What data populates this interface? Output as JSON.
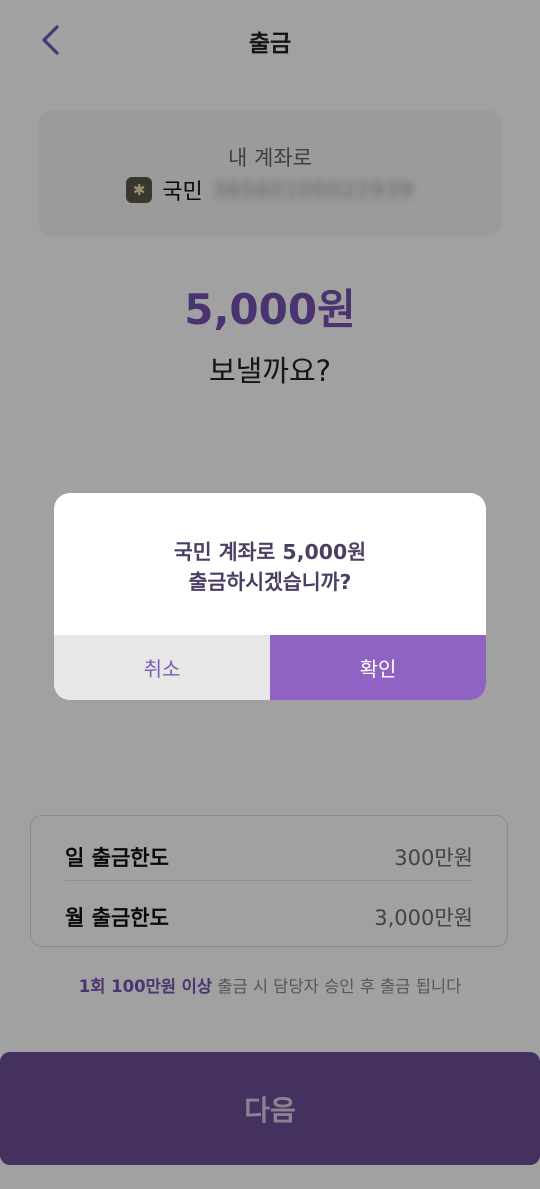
{
  "header": {
    "title": "출금"
  },
  "account": {
    "label": "내 계좌로",
    "bank_name": "국민",
    "account_number": "36560100022939"
  },
  "transfer": {
    "amount": "5,000원",
    "question": "보낼까요?"
  },
  "limits": [
    {
      "label": "일 출금한도",
      "value": "300만원"
    },
    {
      "label": "월 출금한도",
      "value": "3,000만원"
    }
  ],
  "notice": {
    "highlight": "1회 100만원 이상",
    "text": " 출금 시 담당자 승인 후 출금 됩니다"
  },
  "next_button": {
    "label": "다음"
  },
  "dialog": {
    "line1": "국민 계좌로 5,000원",
    "line2": "출금하시겠습니까?",
    "cancel_label": "취소",
    "confirm_label": "확인"
  },
  "colors": {
    "accent": "#7652b0",
    "dialog_confirm": "#8f62c3",
    "next_button": "#6d4e99"
  },
  "icons": {
    "back": "chevron-left-icon",
    "bank": "kb-bank-logo-icon"
  }
}
